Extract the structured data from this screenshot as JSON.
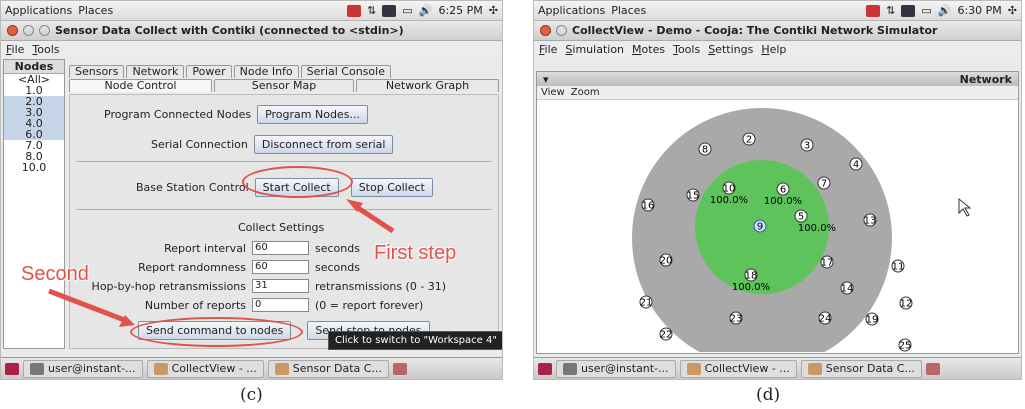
{
  "panel_c": {
    "topbar": {
      "apps": "Applications",
      "places": "Places",
      "clock": "6:25 PM"
    },
    "title": "Sensor Data Collect with Contiki (connected to <stdin>)",
    "menu": [
      "File",
      "Tools"
    ],
    "nodes": {
      "header": "Nodes",
      "items": [
        "<All>",
        "1.0",
        "2.0",
        "3.0",
        "4.0",
        "6.0",
        "7.0",
        "8.0",
        "10.0"
      ]
    },
    "tabs_top": [
      "Sensors",
      "Network",
      "Power",
      "Node Info",
      "Serial Console"
    ],
    "tabs_bottom": [
      "Node Control",
      "Sensor Map",
      "Network Graph"
    ],
    "program_label": "Program Connected Nodes",
    "program_btn": "Program Nodes...",
    "serial_label": "Serial Connection",
    "serial_btn": "Disconnect from serial",
    "base_label": "Base Station Control",
    "start_btn": "Start Collect",
    "stop_btn": "Stop Collect",
    "collect_title": "Collect Settings",
    "settings": [
      {
        "label": "Report interval",
        "value": "60",
        "unit": "seconds"
      },
      {
        "label": "Report randomness",
        "value": "60",
        "unit": "seconds"
      },
      {
        "label": "Hop-by-hop retransmissions",
        "value": "31",
        "unit": "retransmissions (0 - 31)"
      },
      {
        "label": "Number of reports",
        "value": "0",
        "unit": "(0 = report forever)"
      }
    ],
    "send_btn": "Send command to nodes",
    "send_stop_btn": "Send stop to nodes",
    "tooltip": "Click to switch to \"Workspace 4\"",
    "anno_first": "First step",
    "anno_second": "Second",
    "taskbar": [
      "user@instant-...",
      "CollectView - ...",
      "Sensor Data C..."
    ],
    "caption": "(c)"
  },
  "panel_d": {
    "topbar": {
      "apps": "Applications",
      "places": "Places",
      "clock": "6:30 PM"
    },
    "title": "CollectView - Demo - Cooja: The Contiki Network Simulator",
    "menu": [
      "File",
      "Simulation",
      "Motes",
      "Tools",
      "Settings",
      "Help"
    ],
    "network_title": "Network",
    "view_menu": [
      "View",
      "Zoom"
    ],
    "motes": [
      {
        "id": "2"
      },
      {
        "id": "3"
      },
      {
        "id": "8"
      },
      {
        "id": "4"
      },
      {
        "id": "7"
      },
      {
        "id": "10",
        "pct": "100.0%"
      },
      {
        "id": "6",
        "pct": "100.0%"
      },
      {
        "id": "5",
        "pct": "100.0%"
      },
      {
        "id": "15"
      },
      {
        "id": "16"
      },
      {
        "id": "13"
      },
      {
        "id": "9"
      },
      {
        "id": "20"
      },
      {
        "id": "17"
      },
      {
        "id": "11"
      },
      {
        "id": "18",
        "pct": "100.0%"
      },
      {
        "id": "14"
      },
      {
        "id": "21"
      },
      {
        "id": "12"
      },
      {
        "id": "23"
      },
      {
        "id": "24"
      },
      {
        "id": "19"
      },
      {
        "id": "22"
      },
      {
        "id": "25"
      }
    ],
    "taskbar": [
      "user@instant-...",
      "CollectView - ...",
      "Sensor Data C..."
    ],
    "caption": "(d)"
  },
  "colors": {
    "outer_ring": "#a9a9a9",
    "inner_ring": "#5ec35a",
    "annotation": "#e0534a"
  }
}
